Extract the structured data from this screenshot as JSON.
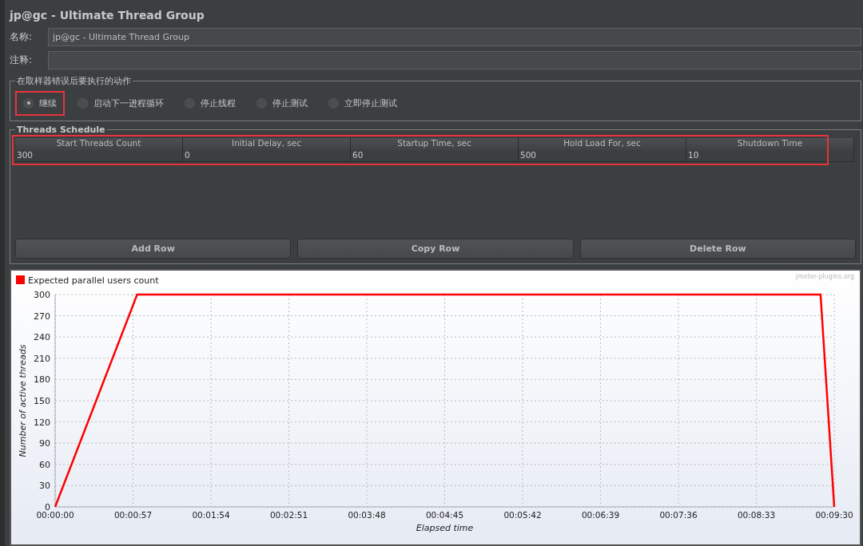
{
  "title": "jp@gc - Ultimate Thread Group",
  "fields": [
    {
      "label": "名称:",
      "value": "jp@gc - Ultimate Thread Group"
    },
    {
      "label": "注释:"
    }
  ],
  "error_action": {
    "legend": "在取样器错误后要执行的动作",
    "options": [
      {
        "label": "继续",
        "selected": true,
        "highlighted": true
      },
      {
        "label": "启动下一进程循环",
        "selected": false,
        "highlighted": false
      },
      {
        "label": "停止线程",
        "selected": false,
        "highlighted": false
      },
      {
        "label": "停止测试",
        "selected": false,
        "highlighted": false
      },
      {
        "label": "立即停止测试",
        "selected": false,
        "highlighted": false
      }
    ]
  },
  "schedule": {
    "legend": "Threads Schedule",
    "highlighted": true,
    "columns": [
      "Start Threads Count",
      "Initial Delay, sec",
      "Startup Time, sec",
      "Hold Load For, sec",
      "Shutdown Time"
    ],
    "rows": [
      [
        "300",
        "0",
        "60",
        "500",
        "10"
      ]
    ],
    "buttons": [
      "Add Row",
      "Copy Row",
      "Delete Row"
    ]
  },
  "chart": {
    "credit": "jmeter-plugins.org",
    "chart_data": {
      "type": "line",
      "xlabel": "Elapsed time",
      "ylabel": "Number of active threads",
      "x": [
        0,
        60,
        560,
        570
      ],
      "series": [
        {
          "name": "Expected parallel users count",
          "color": "#ff0000",
          "values": [
            0,
            300,
            300,
            0
          ]
        }
      ],
      "grid": true,
      "xlim": [
        0,
        570
      ],
      "ylim": [
        0,
        300
      ],
      "xticks": [
        {
          "value": 0,
          "label": "00:00:00"
        },
        {
          "value": 57,
          "label": "00:00:57"
        },
        {
          "value": 114,
          "label": "00:01:54"
        },
        {
          "value": 171,
          "label": "00:02:51"
        },
        {
          "value": 228,
          "label": "00:03:48"
        },
        {
          "value": 285,
          "label": "00:04:45"
        },
        {
          "value": 342,
          "label": "00:05:42"
        },
        {
          "value": 399,
          "label": "00:06:39"
        },
        {
          "value": 456,
          "label": "00:07:36"
        },
        {
          "value": 513,
          "label": "00:08:33"
        },
        {
          "value": 570,
          "label": "00:09:30"
        }
      ],
      "yticks": [
        0,
        30,
        60,
        90,
        120,
        150,
        180,
        210,
        240,
        270,
        300
      ]
    }
  }
}
